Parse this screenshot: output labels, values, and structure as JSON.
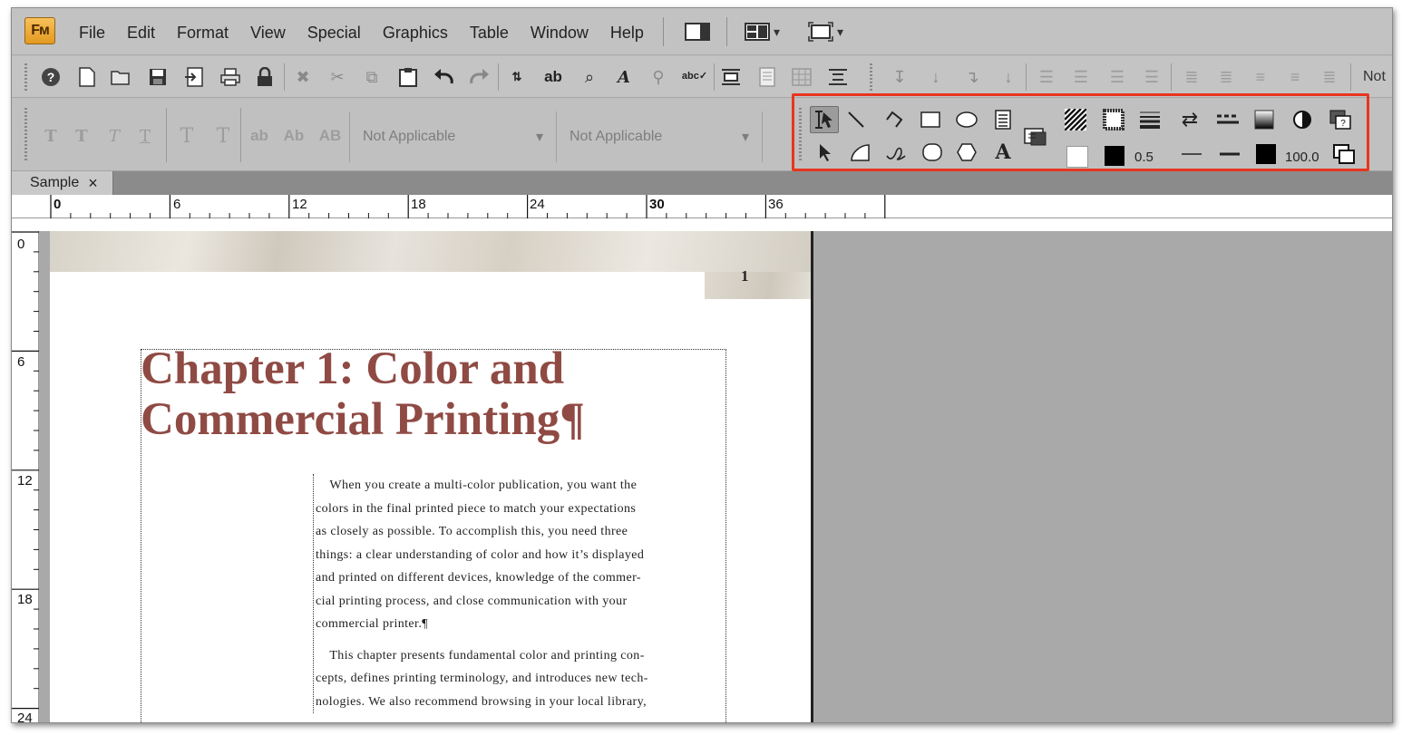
{
  "app": {
    "logo": "Fм"
  },
  "menu": [
    "File",
    "Edit",
    "Format",
    "View",
    "Special",
    "Graphics",
    "Table",
    "Window",
    "Help"
  ],
  "toolbar1": {
    "right_text": "Not"
  },
  "toolbar2": {
    "combo1": "Not Applicable",
    "combo2": "Not Applicable",
    "text_styles": [
      "T",
      "T",
      "T",
      "T",
      "T",
      "T",
      "ab",
      "Ab",
      "AB"
    ]
  },
  "graphics_toolbar": {
    "border_width": "0.5",
    "tint": "100.0",
    "highlight_color": "#e8351f"
  },
  "tab": {
    "label": "Sample",
    "close": "×"
  },
  "hruler": {
    "labels": [
      "0",
      "6",
      "12",
      "18",
      "24",
      "30",
      "36"
    ]
  },
  "vruler": {
    "labels": [
      "0",
      "6",
      "12",
      "18",
      "24"
    ]
  },
  "page": {
    "page_number": "1",
    "title_line1": "Chapter 1: Color and",
    "title_line2": "Commercial Printing¶",
    "title_color": "#8f4a44",
    "body_lines": [
      "    When you create a multi-color publication, you want the",
      "colors in the final printed piece to match your expectations",
      "as closely as possible. To accomplish this, you need three",
      "things: a clear understanding of color and how it’s displayed",
      "and printed on different devices, knowledge of the commer-",
      "cial printing process, and close communication with your",
      "commercial printer.¶"
    ],
    "body_lines2": [
      "    This chapter presents fundamental color and printing con-",
      "cepts, defines printing terminology, and introduces new tech-",
      "nologies. We also recommend browsing in your local library,"
    ]
  }
}
